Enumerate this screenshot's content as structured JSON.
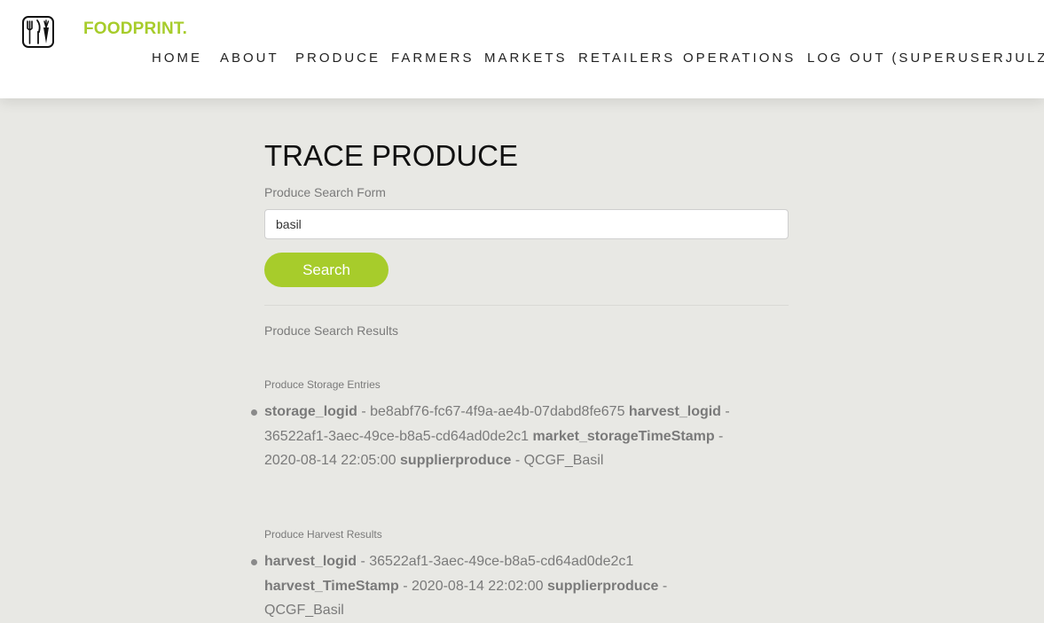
{
  "header": {
    "brand": "FOODPRINT.",
    "nav": [
      {
        "label": "HOME"
      },
      {
        "label": "ABOUT"
      },
      {
        "label": "PRODUCE"
      },
      {
        "label": "FARMERS"
      },
      {
        "label": "MARKETS"
      },
      {
        "label": "RETAILERS"
      },
      {
        "label": "OPERATIONS"
      },
      {
        "label": "LOG OUT (SUPERUSERJULZ)"
      }
    ]
  },
  "page": {
    "title": "TRACE PRODUCE",
    "form_label": "Produce Search Form",
    "search_value": "basil",
    "search_button": "Search",
    "results_heading": "Produce Search Results",
    "storage": {
      "heading": "Produce Storage Entries",
      "entries": [
        {
          "k1": "storage_logid",
          "v1": " - be8abf76-fc67-4f9a-ae4b-07dabd8fe675 ",
          "k2": "harvest_logid",
          "v2": " - 36522af1-3aec-49ce-b8a5-cd64ad0de2c1 ",
          "k3": "market_storageTimeStamp",
          "v3": " - 2020-08-14 22:05:00 ",
          "k4": "supplierproduce",
          "v4": " - QCGF_Basil"
        }
      ]
    },
    "harvest": {
      "heading": "Produce Harvest Results",
      "entries": [
        {
          "k1": "harvest_logid",
          "v1": " - 36522af1-3aec-49ce-b8a5-cd64ad0de2c1 ",
          "k2": "harvest_TimeStamp",
          "v2": " - 2020-08-14 22:02:00 ",
          "k3": "supplierproduce",
          "v3": " - QCGF_Basil"
        }
      ]
    }
  },
  "colors": {
    "accent": "#a7cc2b",
    "page_background": "#e8e8e4",
    "muted_text": "#7a7a7a"
  },
  "icons": {
    "logo": "fork-knife-carrot-icon",
    "bullet": "bullet-dot-icon"
  }
}
